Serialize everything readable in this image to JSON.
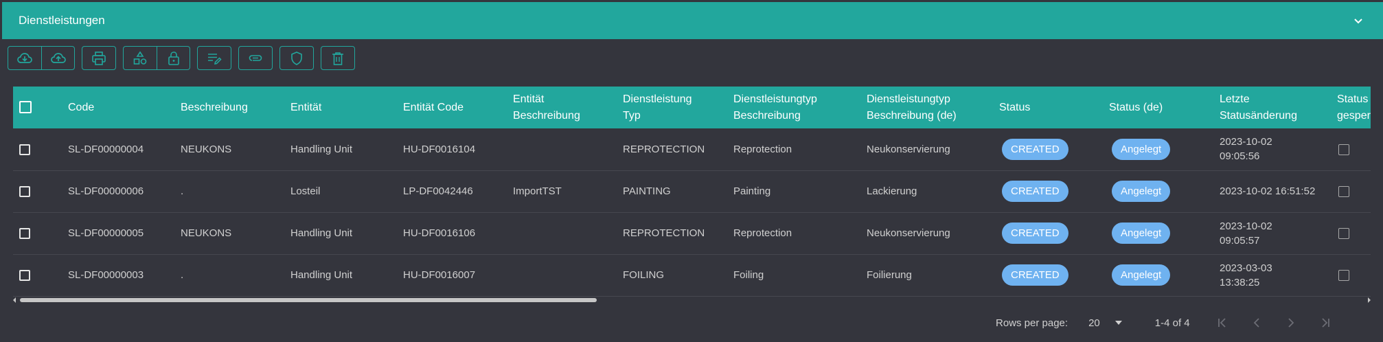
{
  "header": {
    "title": "Dienstleistungen"
  },
  "toolbar": {
    "groups": [
      [
        "cloud-download-icon",
        "cloud-upload-icon"
      ],
      [
        "printer-icon"
      ],
      [
        "shapes-icon",
        "lock-icon"
      ],
      [
        "edit-list-icon"
      ],
      [
        "attachment-icon"
      ],
      [
        "shield-icon"
      ],
      [
        "trash-icon"
      ]
    ]
  },
  "table": {
    "columns": [
      "Code",
      "Beschreibung",
      "Entität",
      "Entität Code",
      "Entität Beschreibung",
      "Dienstleistung Typ",
      "Dienstleistungtyp Beschreibung",
      "Dienstleistungtyp Beschreibung (de)",
      "Status",
      "Status (de)",
      "Letzte Statusänderung",
      "Status gesperrt"
    ],
    "rows": [
      {
        "code": "SL-DF00000004",
        "beschreibung": "NEUKONS",
        "entitaet": "Handling Unit",
        "entitaet_code": "HU-DF0016104",
        "entitaet_beschreibung": "",
        "typ": "REPROTECTION",
        "typ_beschreibung": "Reprotection",
        "typ_beschreibung_de": "Neukonservierung",
        "status": "CREATED",
        "status_de": "Angelegt",
        "letzte_aenderung_date": "2023-10-02",
        "letzte_aenderung_time": "09:05:56"
      },
      {
        "code": "SL-DF00000006",
        "beschreibung": ".",
        "entitaet": "Losteil",
        "entitaet_code": "LP-DF0042446",
        "entitaet_beschreibung": "ImportTST",
        "typ": "PAINTING",
        "typ_beschreibung": "Painting",
        "typ_beschreibung_de": "Lackierung",
        "status": "CREATED",
        "status_de": "Angelegt",
        "letzte_aenderung_date": "2023-10-02 16:51:52",
        "letzte_aenderung_time": ""
      },
      {
        "code": "SL-DF00000005",
        "beschreibung": "NEUKONS",
        "entitaet": "Handling Unit",
        "entitaet_code": "HU-DF0016106",
        "entitaet_beschreibung": "",
        "typ": "REPROTECTION",
        "typ_beschreibung": "Reprotection",
        "typ_beschreibung_de": "Neukonservierung",
        "status": "CREATED",
        "status_de": "Angelegt",
        "letzte_aenderung_date": "2023-10-02",
        "letzte_aenderung_time": "09:05:57"
      },
      {
        "code": "SL-DF00000003",
        "beschreibung": ".",
        "entitaet": "Handling Unit",
        "entitaet_code": "HU-DF0016007",
        "entitaet_beschreibung": "",
        "typ": "FOILING",
        "typ_beschreibung": "Foiling",
        "typ_beschreibung_de": "Foilierung",
        "status": "CREATED",
        "status_de": "Angelegt",
        "letzte_aenderung_date": "2023-03-03",
        "letzte_aenderung_time": "13:38:25"
      }
    ]
  },
  "pagination": {
    "rows_per_page_label": "Rows per page:",
    "rows_per_page_value": "20",
    "range": "1-4 of 4"
  },
  "colors": {
    "accent": "#22a79d",
    "background": "#34353d",
    "badge": "#6fb2f0"
  }
}
